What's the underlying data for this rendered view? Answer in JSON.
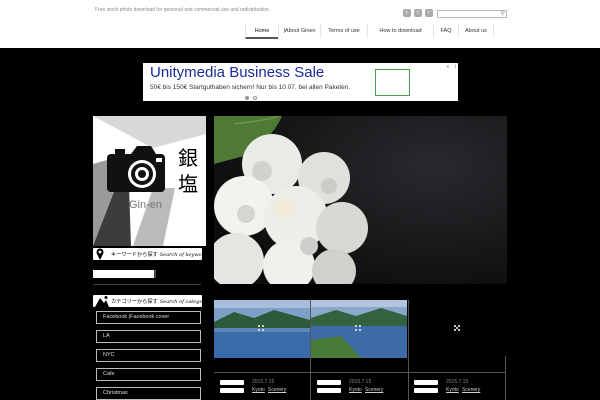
{
  "header": {
    "tagline": "Free stock photo download for personal and commercial use and redistribution.",
    "social_icons": [
      "twitter-icon",
      "facebook-icon",
      "rss-icon"
    ],
    "search_placeholder": "",
    "nav": [
      {
        "label": "Home",
        "active": true
      },
      {
        "label": "|About Ginen",
        "active": false
      },
      {
        "label": "Terms of use",
        "active": false
      },
      {
        "label": "How to download",
        "active": false
      },
      {
        "label": "FAQ",
        "active": false
      },
      {
        "label": "About us",
        "active": false
      }
    ]
  },
  "ad": {
    "title": "Unitymedia Business Sale",
    "text": "50€ bis 150€ Startguthaben sichern! Nur bis 10.07. bei allen Paketen.",
    "info_label": "i",
    "close_label": "x"
  },
  "sidebar": {
    "logo_kanji_1": "銀",
    "logo_kanji_2": "塩",
    "logo_romaji": "Gin-en",
    "keyword_search": {
      "label": "キーワードから探す",
      "script": "Search of keyword",
      "value": ""
    },
    "category_search": {
      "label": "カテゴリーから探す",
      "script": "Search of category"
    },
    "categories": [
      "Facebook |Facebook cover",
      "LA",
      "NYC",
      "Cafe",
      "Christmas"
    ]
  },
  "posts": [
    {
      "title": "",
      "date": "2015.7.15",
      "tags": [
        "Kyoto",
        "Scenery"
      ]
    },
    {
      "title": "",
      "date": "2015.7.15",
      "tags": [
        "Kyoto",
        "Scenery"
      ]
    },
    {
      "title": "",
      "date": "2015.7.15",
      "tags": [
        "Kyoto",
        "Scenery"
      ]
    }
  ],
  "colors": {
    "accent": "#1c2a9c",
    "background": "#000000",
    "header_bg": "#ffffff"
  }
}
